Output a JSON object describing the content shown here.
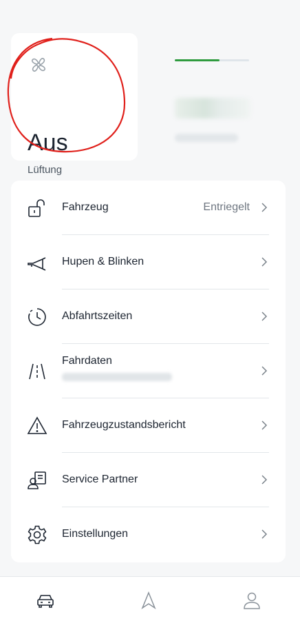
{
  "ventilation": {
    "value": "Aus",
    "label": "Lüftung",
    "icon": "fan-icon"
  },
  "fuel_card": {
    "level_fraction": 0.6,
    "bar_color": "#2e9b3e"
  },
  "menu": {
    "items": [
      {
        "label": "Fahrzeug",
        "status": "Entriegelt",
        "icon": "unlocked-padlock-icon"
      },
      {
        "label": "Hupen & Blinken",
        "icon": "horn-icon"
      },
      {
        "label": "Abfahrtszeiten",
        "icon": "clock-icon"
      },
      {
        "label": "Fahrdaten",
        "icon": "road-icon"
      },
      {
        "label": "Fahrzeugzustandsbericht",
        "icon": "warning-triangle-icon"
      },
      {
        "label": "Service Partner",
        "icon": "service-partner-icon"
      },
      {
        "label": "Einstellungen",
        "icon": "gear-icon"
      }
    ]
  },
  "bottom_nav": {
    "tabs": [
      {
        "icon": "car-icon",
        "active": true
      },
      {
        "icon": "navigation-arrow-icon",
        "active": false
      },
      {
        "icon": "profile-icon",
        "active": false
      }
    ]
  }
}
